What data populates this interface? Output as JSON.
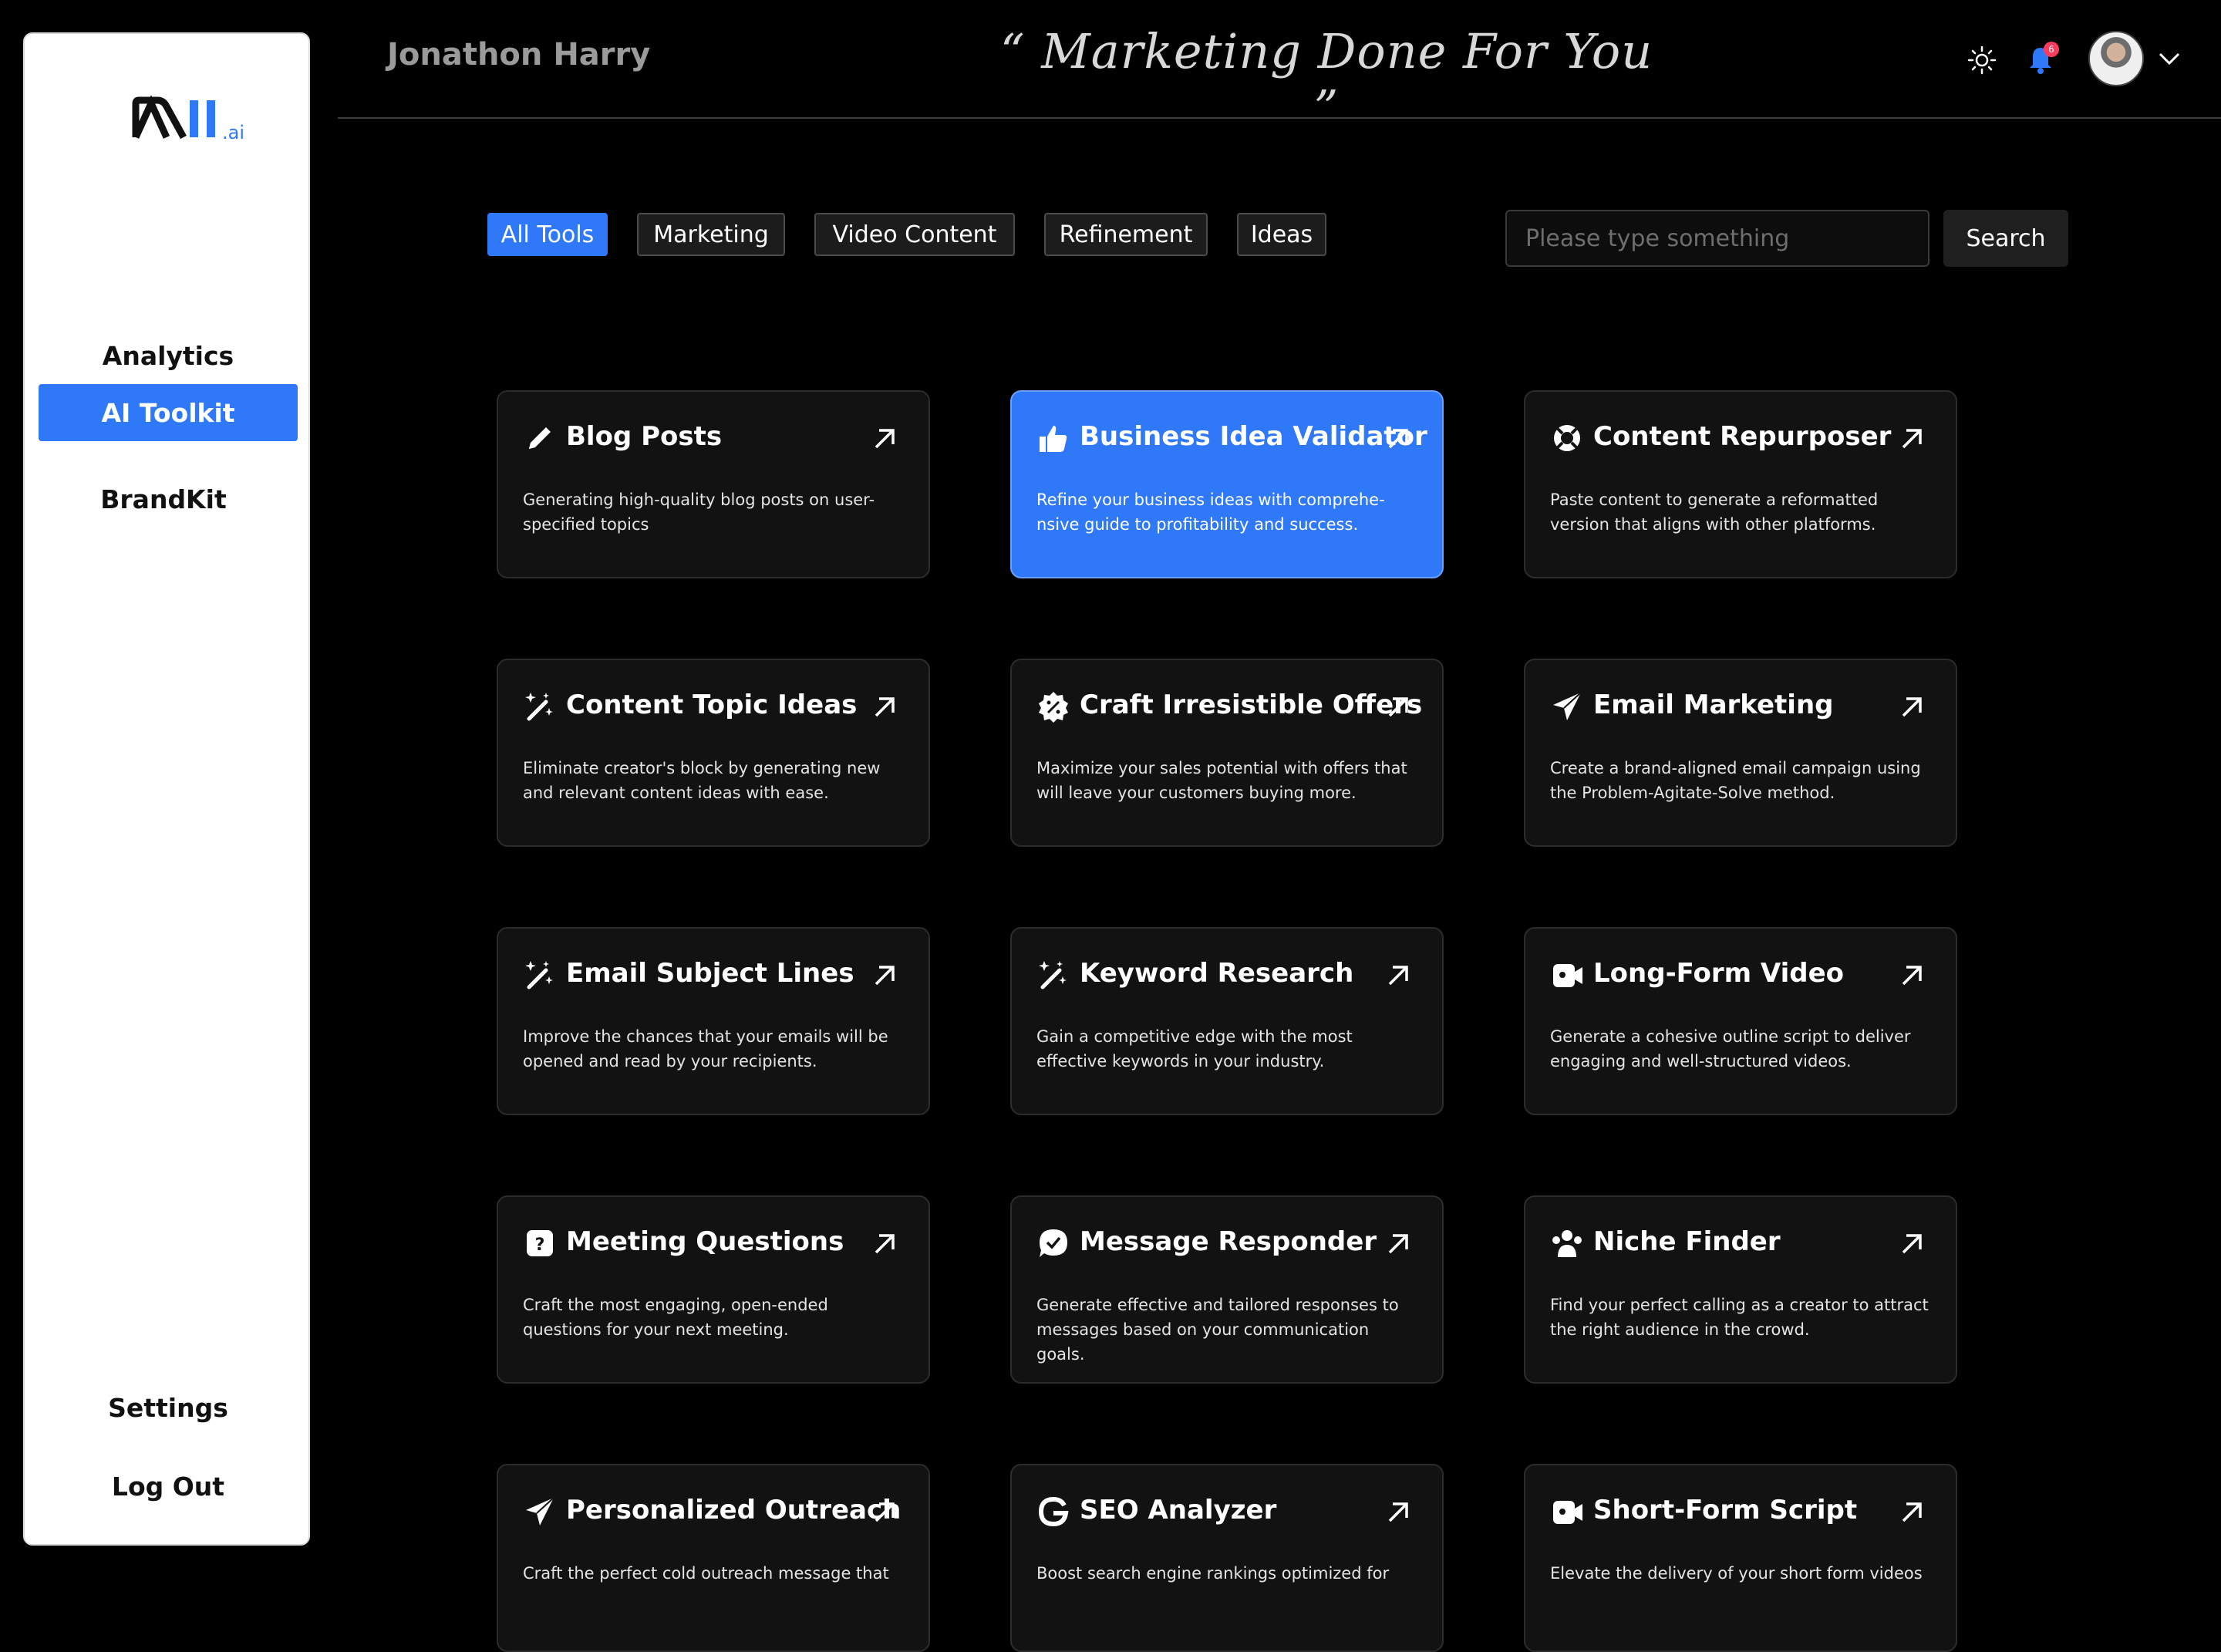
{
  "sidebar": {
    "logo_text": "M||.ai",
    "items": [
      {
        "label": "Analytics"
      },
      {
        "label": "AI Toolkit"
      },
      {
        "label": "BrandKit"
      }
    ],
    "bottom": [
      {
        "label": "Settings"
      },
      {
        "label": "Log Out"
      }
    ]
  },
  "header": {
    "user_name": "Jonathon Harry",
    "tagline": "“ Marketing Done For You ”",
    "notification_count": "6",
    "icons": [
      "sun-icon",
      "bell-icon",
      "avatar",
      "chevron-down-icon"
    ]
  },
  "filters": {
    "tabs": [
      {
        "label": "All Tools"
      },
      {
        "label": "Marketing"
      },
      {
        "label": "Video Content"
      },
      {
        "label": "Refinement"
      },
      {
        "label": "Ideas"
      }
    ],
    "selected": "All Tools"
  },
  "search": {
    "placeholder": "Please type something",
    "value": "",
    "button_label": "Search"
  },
  "colors": {
    "accent": "#2f78f7",
    "card_bg": "#121212",
    "page_bg": "#000000"
  },
  "tools": [
    {
      "title": "Blog Posts",
      "desc": "Generating high-quality blog posts on user-specified topics",
      "icon": "pencil-icon"
    },
    {
      "title": "Business Idea Validator",
      "desc": "Refine your business ideas with comprehe-nsive guide to profitability and success.",
      "icon": "thumbs-up-icon"
    },
    {
      "title": "Content Repurposer",
      "desc": "Paste content to generate a reformatted version that aligns with other platforms.",
      "icon": "lifebuoy-icon"
    },
    {
      "title": "Content Topic Ideas",
      "desc": "Eliminate creator's block by generating new and relevant content ideas with ease.",
      "icon": "magic-wand-icon"
    },
    {
      "title": "Craft Irresistible Offers",
      "desc": "Maximize your sales potential with offers that will leave your customers buying more.",
      "icon": "discount-badge-icon"
    },
    {
      "title": "Email Marketing",
      "desc": "Create a brand-aligned email campaign using the Problem-Agitate-Solve method.",
      "icon": "paper-plane-icon"
    },
    {
      "title": "Email Subject Lines",
      "desc": "Improve the chances that your emails will be opened and read by your recipients.",
      "icon": "magic-wand-icon"
    },
    {
      "title": "Keyword Research",
      "desc": "Gain a competitive edge with the most effective keywords in your industry.",
      "icon": "magic-wand-icon"
    },
    {
      "title": "Long-Form Video",
      "desc": "Generate a cohesive outline script to deliver engaging and well-structured videos.",
      "icon": "video-camera-icon"
    },
    {
      "title": "Meeting Questions",
      "desc": "Craft the most engaging, open-ended questions for your next meeting.",
      "icon": "question-box-icon"
    },
    {
      "title": "Message Responder",
      "desc": "Generate effective and tailored responses to messages based on your communication goals.",
      "icon": "chat-check-icon"
    },
    {
      "title": "Niche Finder",
      "desc": "Find your perfect calling as a creator to attract the right audience in the crowd.",
      "icon": "users-icon"
    },
    {
      "title": "Personalized Outreach",
      "desc": "Craft the perfect cold outreach message that",
      "icon": "paper-plane-icon"
    },
    {
      "title": "SEO Analyzer",
      "desc": "Boost search engine rankings optimized for",
      "icon": "google-g-icon"
    },
    {
      "title": "Short-Form Script",
      "desc": "Elevate the delivery of your short form videos",
      "icon": "video-camera-icon"
    }
  ]
}
